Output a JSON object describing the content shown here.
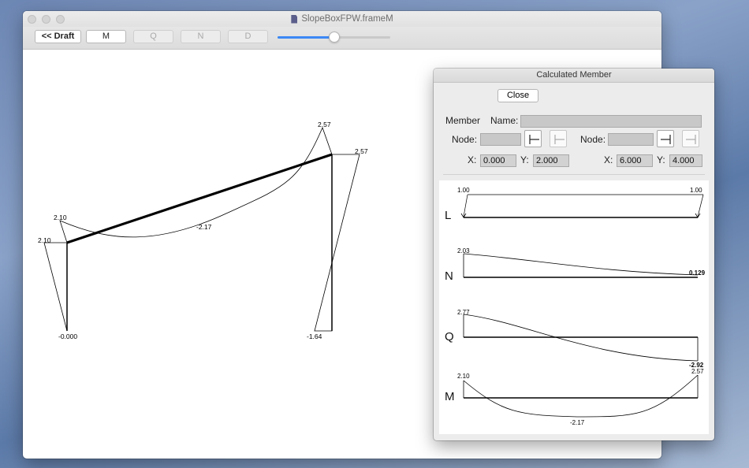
{
  "window": {
    "title": "SlopeBoxFPW.frameM"
  },
  "toolbar": {
    "draft_label": "<< Draft",
    "m_label": "M",
    "q_label": "Q",
    "n_label": "N",
    "d_label": "D",
    "slider_value": 0.5
  },
  "frame_labels": {
    "left_base": "-0.000",
    "left_top": "2.10",
    "left_top_upper": "2.10",
    "beam_mid": "-2.17",
    "right_top_upper": "2.57",
    "right_top": "2.57",
    "right_base": "-1.64"
  },
  "panel": {
    "title": "Calculated Member",
    "close_label": "Close",
    "member_label": "Member",
    "name_label": "Name:",
    "name_value": "",
    "node_label": "Node:",
    "node_left_value": "",
    "node_right_value": "",
    "x_label": "X:",
    "y_label": "Y:",
    "left_x": "0.000",
    "left_y": "2.000",
    "right_x": "6.000",
    "right_y": "4.000"
  },
  "diagrams": {
    "L": {
      "letter": "L",
      "start": "1.00",
      "end": "1.00"
    },
    "N": {
      "letter": "N",
      "start": "2.03",
      "end": "0.129"
    },
    "Q": {
      "letter": "Q",
      "start": "2.77",
      "end": "-2.92"
    },
    "M": {
      "letter": "M",
      "start": "2.10",
      "end": "2.57",
      "min": "-2.17"
    }
  }
}
